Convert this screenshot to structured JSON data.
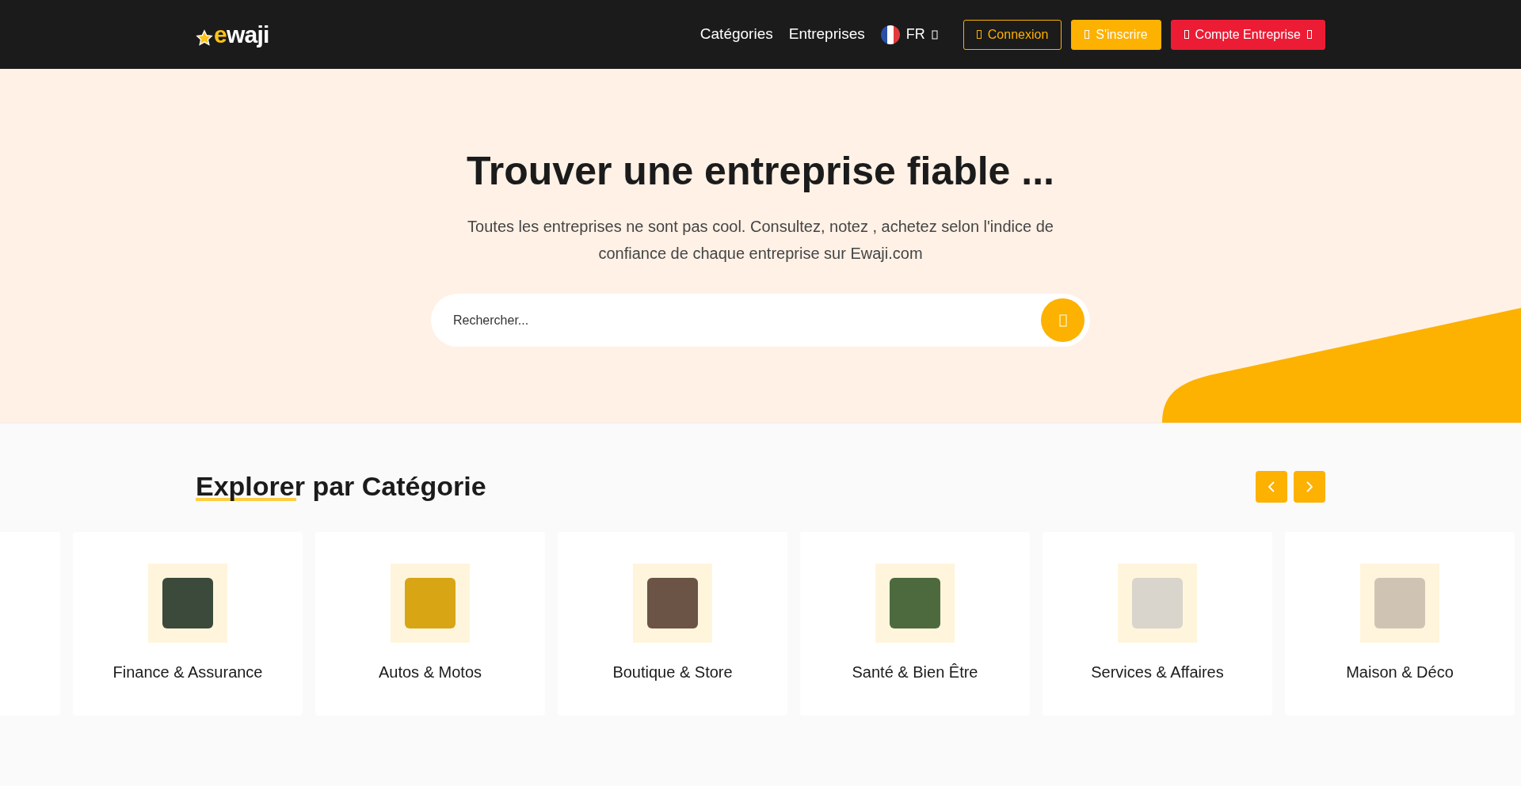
{
  "header": {
    "logo": "ewaji",
    "nav": [
      "Catégories",
      "Entreprises"
    ],
    "language": "FR",
    "buttons": [
      {
        "label": "Connexion",
        "kind": "outline"
      },
      {
        "label": "S'inscrire",
        "kind": "primary"
      },
      {
        "label": "Compte Entreprise",
        "kind": "danger"
      }
    ]
  },
  "hero": {
    "title": "Trouver une entreprise fiable ...",
    "subtitle": "Toutes les entreprises ne sont pas cool. Consultez, notez , achetez selon l'indice de confiance de chaque entreprise sur Ewaji.com",
    "search": {
      "placeholder": "Rechercher..."
    }
  },
  "categories": {
    "title": "Explorer par Catégorie",
    "items": [
      {
        "label": "Finance & Assurance"
      },
      {
        "label": "Autos & Motos"
      },
      {
        "label": "Boutique & Store"
      },
      {
        "label": "Santé & Bien Être"
      },
      {
        "label": "Services & Affaires"
      },
      {
        "label": "Maison & Déco"
      }
    ]
  }
}
